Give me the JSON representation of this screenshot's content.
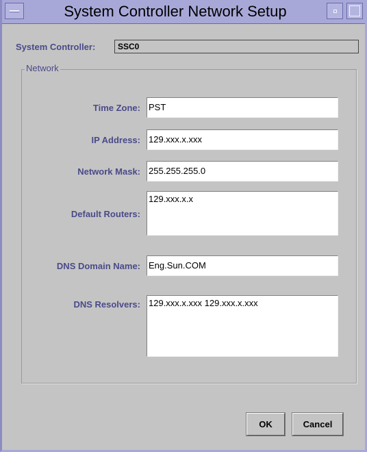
{
  "window": {
    "title": "System Controller Network Setup"
  },
  "system_controller": {
    "label": "System Controller:",
    "value": "SSC0"
  },
  "network": {
    "group_title": "Network",
    "time_zone_label": "Time Zone:",
    "time_zone_value": "PST",
    "ip_address_label": "IP Address:",
    "ip_address_value": "129.xxx.x.xxx",
    "network_mask_label": "Network Mask:",
    "network_mask_value": "255.255.255.0",
    "default_routers_label": "Default Routers:",
    "default_routers_value": "129.xxx.x.x",
    "dns_domain_label": "DNS Domain Name:",
    "dns_domain_value": "Eng.Sun.COM",
    "dns_resolvers_label": "DNS Resolvers:",
    "dns_resolvers_value": "129.xxx.x.xxx 129.xxx.x.xxx"
  },
  "buttons": {
    "ok": "OK",
    "cancel": "Cancel"
  },
  "icons": {
    "window_menu": "window-menu-icon",
    "minimize": "minimize-icon",
    "maximize": "maximize-icon"
  }
}
